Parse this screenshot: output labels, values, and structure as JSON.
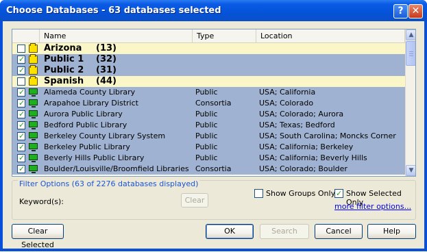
{
  "window": {
    "title": "Choose Databases - 63 databases selected",
    "help_glyph": "?",
    "close_glyph": "✕"
  },
  "table": {
    "columns": [
      "Name",
      "Type",
      "Location"
    ],
    "groups": [
      {
        "name": "Arizona",
        "count": "(13)",
        "checked": false
      },
      {
        "name": "Public 1",
        "count": "(32)",
        "checked": true
      },
      {
        "name": "Public 2",
        "count": "(31)",
        "checked": true
      },
      {
        "name": "Spanish",
        "count": "(44)",
        "checked": false
      }
    ],
    "rows": [
      {
        "name": "Alameda County Library",
        "type": "Public",
        "location": "USA; California",
        "checked": true
      },
      {
        "name": "Arapahoe Library District",
        "type": "Consortia",
        "location": "USA; Colorado",
        "checked": true
      },
      {
        "name": "Aurora Public Library",
        "type": "Public",
        "location": "USA; Colorado; Aurora",
        "checked": true
      },
      {
        "name": "Bedford Public Library",
        "type": "Public",
        "location": "USA; Texas; Bedford",
        "checked": true
      },
      {
        "name": "Berkeley County Library System",
        "type": "Public",
        "location": "USA; South Carolina; Moncks Corner",
        "checked": true
      },
      {
        "name": "Berkeley Public Library",
        "type": "Public",
        "location": "USA; California; Berkeley",
        "checked": true
      },
      {
        "name": "Beverly Hills Public Library",
        "type": "Public",
        "location": "USA; California; Beverly Hills",
        "checked": true
      },
      {
        "name": "Boulder/Louisville/Broomfield Libraries",
        "type": "Consortia",
        "location": "USA; Colorado; Boulder",
        "checked": true
      }
    ]
  },
  "filters": {
    "legend": "Filter Options (63 of 2276 databases displayed)",
    "keyword_label": "Keyword(s):",
    "clear_label": "Clear",
    "show_groups_only": {
      "label": "Show Groups Only",
      "checked": false
    },
    "show_selected_only": {
      "label": "Show Selected Only",
      "checked": true
    },
    "more_link": "more filter options..."
  },
  "buttons": {
    "clear_selected": "Clear Selected",
    "ok": "OK",
    "search": "Search",
    "cancel": "Cancel",
    "help": "Help"
  },
  "colors": {
    "title_bar": "#0553d8",
    "group_row_unselected": "#fbf6c8",
    "selected_row": "#9fb2d2",
    "link": "#0000ee"
  }
}
